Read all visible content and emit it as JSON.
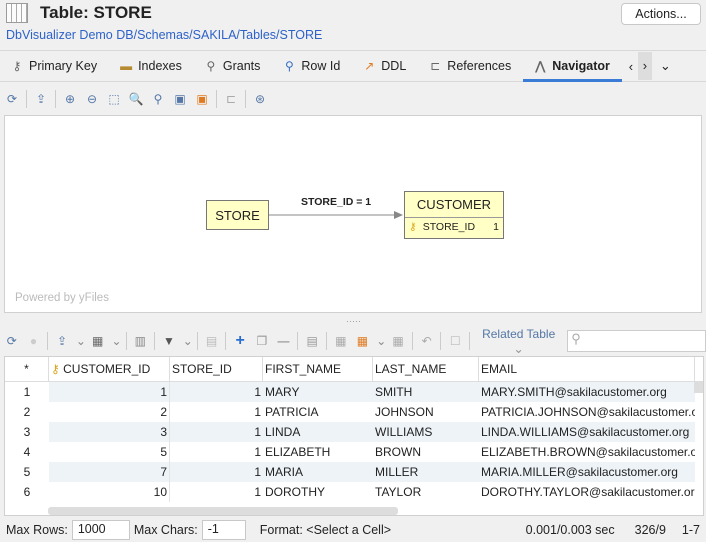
{
  "header": {
    "title": "Table: STORE",
    "actions_label": "Actions...",
    "breadcrumb": "DbVisualizer Demo DB/Schemas/SAKILA/Tables/STORE"
  },
  "tabs": [
    {
      "label": "Primary Key",
      "icon": "key-icon"
    },
    {
      "label": "Indexes",
      "icon": "index-icon"
    },
    {
      "label": "Grants",
      "icon": "grants-icon"
    },
    {
      "label": "Row Id",
      "icon": "pin-icon"
    },
    {
      "label": "DDL",
      "icon": "hammer-icon"
    },
    {
      "label": "References",
      "icon": "references-icon"
    },
    {
      "label": "Navigator",
      "icon": "compass-icon",
      "active": true
    }
  ],
  "graph": {
    "source_node": "STORE",
    "target_node": "CUSTOMER",
    "target_column": "STORE_ID",
    "target_column_value": "1",
    "edge_label": "STORE_ID = 1",
    "watermark": "Powered by yFiles"
  },
  "grid_toolbar": {
    "related_table_label": "Related Table",
    "search_placeholder": ""
  },
  "grid": {
    "columns": [
      "*",
      "CUSTOMER_ID",
      "STORE_ID",
      "FIRST_NAME",
      "LAST_NAME",
      "EMAIL"
    ],
    "rows": [
      [
        "1",
        "1",
        "1",
        "MARY",
        "SMITH",
        "MARY.SMITH@sakilacustomer.org"
      ],
      [
        "2",
        "2",
        "1",
        "PATRICIA",
        "JOHNSON",
        "PATRICIA.JOHNSON@sakilacustomer.org"
      ],
      [
        "3",
        "3",
        "1",
        "LINDA",
        "WILLIAMS",
        "LINDA.WILLIAMS@sakilacustomer.org"
      ],
      [
        "4",
        "5",
        "1",
        "ELIZABETH",
        "BROWN",
        "ELIZABETH.BROWN@sakilacustomer.org"
      ],
      [
        "5",
        "7",
        "1",
        "MARIA",
        "MILLER",
        "MARIA.MILLER@sakilacustomer.org"
      ],
      [
        "6",
        "10",
        "1",
        "DOROTHY",
        "TAYLOR",
        "DOROTHY.TAYLOR@sakilacustomer.org"
      ]
    ]
  },
  "status": {
    "max_rows_label": "Max Rows:",
    "max_rows": "1000",
    "max_chars_label": "Max Chars:",
    "max_chars": "-1",
    "format": "Format: <Select a Cell>",
    "timing": "0.001/0.003 sec",
    "dims": "326/9",
    "range": "1-7"
  }
}
